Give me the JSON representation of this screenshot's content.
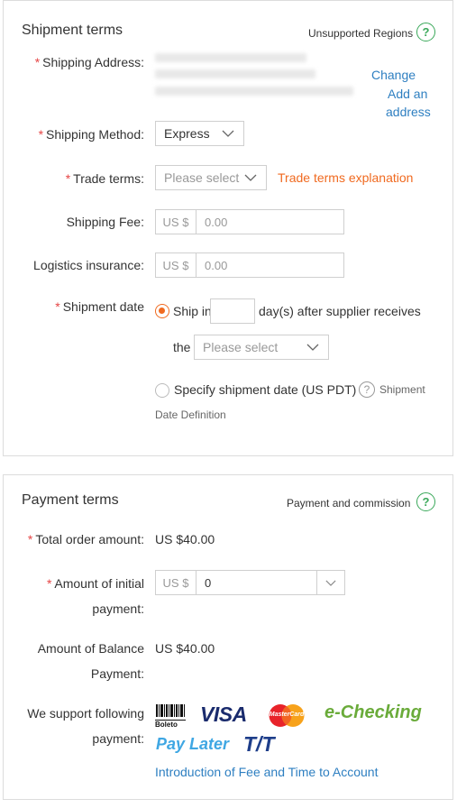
{
  "shipment": {
    "title": "Shipment terms",
    "unsupported_regions": "Unsupported Regions",
    "help_glyph": "?",
    "shipping_address_label": "Shipping Address:",
    "change_link": "Change",
    "add_link_1": "Add an",
    "add_link_2": "address",
    "shipping_method_label": "Shipping Method:",
    "shipping_method_value": "Express",
    "trade_terms_label": "Trade terms:",
    "trade_terms_placeholder": "Please select",
    "trade_terms_explanation": "Trade terms explanation",
    "shipping_fee_label": "Shipping Fee:",
    "currency_prefix": "US $",
    "shipping_fee_placeholder": "0.00",
    "logistics_label": "Logistics insurance:",
    "logistics_placeholder": "0.00",
    "shipment_date_label": "Shipment date",
    "ship_in": "Ship in",
    "after_text": "day(s) after supplier receives",
    "the_text": "the",
    "the_placeholder": "Please select",
    "specify_text": "Specify shipment date (US PDT)",
    "shipment_def_1": "Shipment",
    "shipment_def_2": "Date Definition",
    "required_mark": "*"
  },
  "payment": {
    "title": "Payment terms",
    "commission_link": "Payment and commission",
    "help_glyph": "?",
    "total_label": "Total order amount:",
    "total_value": "US $40.00",
    "initial_label_1": "Amount of initial",
    "initial_label_2": "payment:",
    "initial_prefix": "US $",
    "initial_value": "0",
    "balance_label_1": "Amount of Balance",
    "balance_label_2": "Payment:",
    "balance_value": "US $40.00",
    "support_label_1": "We support following",
    "support_label_2": "payment:",
    "logos": {
      "boleto": "Boleto",
      "visa": "VISA",
      "mastercard": "MasterCard",
      "echecking": "e-Checking",
      "paylater": "Pay Later",
      "tt": "T/T"
    },
    "fee_link": "Introduction of Fee and Time to Account",
    "required_mark": "*"
  },
  "colors": {
    "accent_orange": "#f06a20",
    "link_blue": "#2e7fc1",
    "required_red": "#e64545",
    "help_green": "#3aa85a"
  }
}
